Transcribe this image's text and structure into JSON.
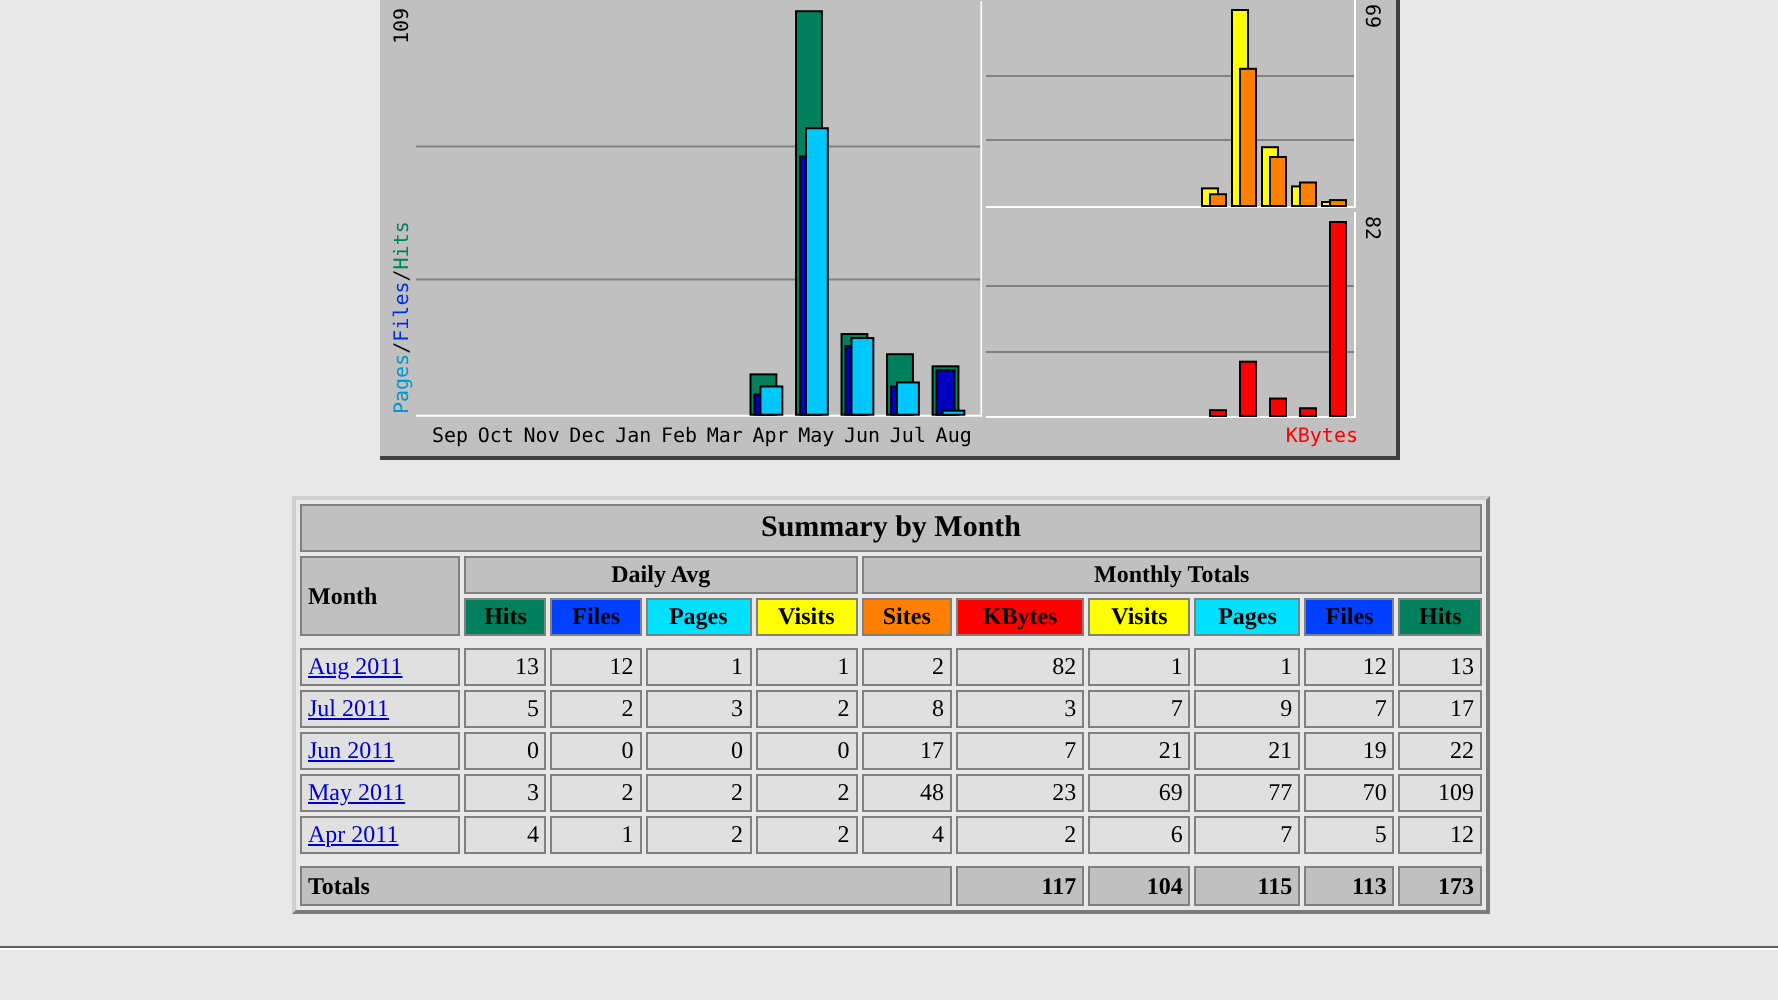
{
  "usage_graph": {
    "main_plot": {
      "max_label": "109",
      "legend_separator": "/",
      "legend": [
        {
          "text": "Pages",
          "color": "#0098d0"
        },
        {
          "text": "Files",
          "color": "#0030e0"
        },
        {
          "text": "Hits",
          "color": "#00805c"
        }
      ],
      "months": [
        "Sep",
        "Oct",
        "Nov",
        "Dec",
        "Jan",
        "Feb",
        "Mar",
        "Apr",
        "May",
        "Jun",
        "Jul",
        "Aug"
      ]
    },
    "visits_plot": {
      "max_label": "69"
    },
    "kbytes_plot": {
      "max_label": "82",
      "legend": {
        "text": "KBytes",
        "color": "#ff0000"
      }
    }
  },
  "summary_table": {
    "title": "Summary by Month",
    "month_header": "Month",
    "groups": [
      {
        "label": "Daily Avg",
        "columns": [
          {
            "label": "Hits",
            "color": "#00805c"
          },
          {
            "label": "Files",
            "color": "#0040ff"
          },
          {
            "label": "Pages",
            "color": "#00e0ff"
          },
          {
            "label": "Visits",
            "color": "#ffff00"
          }
        ]
      },
      {
        "label": "Monthly Totals",
        "columns": [
          {
            "label": "Sites",
            "color": "#ff8000"
          },
          {
            "label": "KBytes",
            "color": "#ff0000"
          },
          {
            "label": "Visits",
            "color": "#ffff00"
          },
          {
            "label": "Pages",
            "color": "#00e0ff"
          },
          {
            "label": "Files",
            "color": "#0040ff"
          },
          {
            "label": "Hits",
            "color": "#00805c"
          }
        ]
      }
    ],
    "rows": [
      {
        "month": "Aug 2011",
        "values": [
          "13",
          "12",
          "1",
          "1",
          "2",
          "82",
          "1",
          "1",
          "12",
          "13"
        ]
      },
      {
        "month": "Jul 2011",
        "values": [
          "5",
          "2",
          "3",
          "2",
          "8",
          "3",
          "7",
          "9",
          "7",
          "17"
        ]
      },
      {
        "month": "Jun 2011",
        "values": [
          "0",
          "0",
          "0",
          "0",
          "17",
          "7",
          "21",
          "21",
          "19",
          "22"
        ]
      },
      {
        "month": "May 2011",
        "values": [
          "3",
          "2",
          "2",
          "2",
          "48",
          "23",
          "69",
          "77",
          "70",
          "109"
        ]
      },
      {
        "month": "Apr 2011",
        "values": [
          "4",
          "1",
          "2",
          "2",
          "4",
          "2",
          "6",
          "7",
          "5",
          "12"
        ]
      }
    ],
    "totals": {
      "label": "Totals",
      "values": [
        "117",
        "104",
        "115",
        "113",
        "173"
      ]
    }
  }
}
